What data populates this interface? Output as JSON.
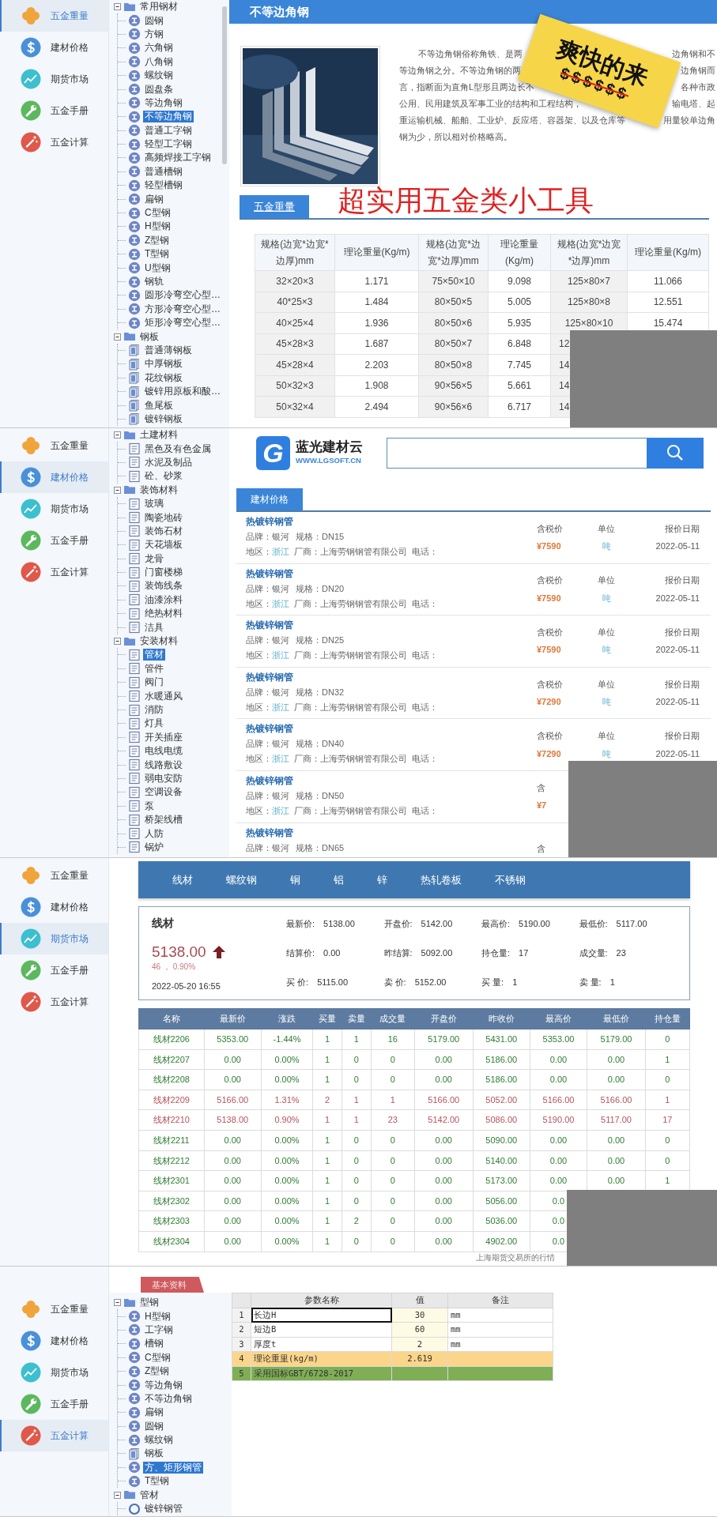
{
  "panels": [
    {
      "kind": "weight",
      "nav": [
        {
          "label": "五金重量",
          "selected": true
        },
        {
          "label": "建材价格",
          "selected": false
        },
        {
          "label": "期货市场",
          "selected": false
        },
        {
          "label": "五金手册",
          "selected": false
        },
        {
          "label": "五金计算",
          "selected": false
        }
      ],
      "tree": [
        {
          "label": "常用钢材",
          "kind": "folder",
          "expanded": true,
          "selected": false,
          "children": [
            {
              "label": "圆钢",
              "kind": "ibeam",
              "selected": false
            },
            {
              "label": "方钢",
              "kind": "ibeam",
              "selected": false
            },
            {
              "label": "六角钢",
              "kind": "ibeam",
              "selected": false
            },
            {
              "label": "八角钢",
              "kind": "ibeam",
              "selected": false
            },
            {
              "label": "螺纹钢",
              "kind": "ibeam",
              "selected": false
            },
            {
              "label": "圆盘条",
              "kind": "ibeam",
              "selected": false
            },
            {
              "label": "等边角钢",
              "kind": "ibeam",
              "selected": false
            },
            {
              "label": "不等边角钢",
              "kind": "ibeam",
              "selected": true
            },
            {
              "label": "普通工字钢",
              "kind": "ibeam",
              "selected": false
            },
            {
              "label": "轻型工字钢",
              "kind": "ibeam",
              "selected": false
            },
            {
              "label": "高频焊接工字钢",
              "kind": "ibeam",
              "selected": false
            },
            {
              "label": "普通槽钢",
              "kind": "ibeam",
              "selected": false
            },
            {
              "label": "轻型槽钢",
              "kind": "ibeam",
              "selected": false
            },
            {
              "label": "扁钢",
              "kind": "ibeam",
              "selected": false
            },
            {
              "label": "C型钢",
              "kind": "ibeam",
              "selected": false
            },
            {
              "label": "H型钢",
              "kind": "ibeam",
              "selected": false
            },
            {
              "label": "Z型钢",
              "kind": "ibeam",
              "selected": false
            },
            {
              "label": "T型钢",
              "kind": "ibeam",
              "selected": false
            },
            {
              "label": "U型钢",
              "kind": "ibeam",
              "selected": false
            },
            {
              "label": "钢轨",
              "kind": "ibeam",
              "selected": false
            },
            {
              "label": "圆形冷弯空心型…",
              "kind": "ibeam",
              "selected": false
            },
            {
              "label": "方形冷弯空心型…",
              "kind": "ibeam",
              "selected": false
            },
            {
              "label": "矩形冷弯空心型…",
              "kind": "ibeam",
              "selected": false
            }
          ]
        },
        {
          "label": "钢板",
          "kind": "folder",
          "expanded": true,
          "selected": false,
          "children": [
            {
              "label": "普通薄钢板",
              "kind": "plate",
              "selected": false
            },
            {
              "label": "中厚钢板",
              "kind": "plate",
              "selected": false
            },
            {
              "label": "花纹钢板",
              "kind": "plate",
              "selected": false
            },
            {
              "label": "镀锌用原板和酸…",
              "kind": "plate",
              "selected": false
            },
            {
              "label": "鱼尾板",
              "kind": "plate",
              "selected": false
            },
            {
              "label": "镀锌钢板",
              "kind": "plate",
              "selected": false
            }
          ]
        }
      ],
      "content": {
        "title": "不等边角钢",
        "description": {
          "lines": [
            {
              "left": "不等边角钢俗称角铁、是两",
              "right": "边角钢和不"
            },
            {
              "left": "等边角钢之分。不等边角钢的两",
              "right": "边角钢而"
            },
            {
              "left": "言，指断面为直角L型形且两边长不",
              "right": "各种市政"
            },
            {
              "left": "公用、民用建筑及军事工业的结构和工程结构，",
              "right": "输电塔、起"
            },
            {
              "left": "重运输机械、船舶、工业炉、反应塔、容器架、以及仓库等",
              "right": "用量较单边角"
            }
          ],
          "last": "钢为少，所以相对价格略高。"
        },
        "sticker": {
          "title": "爽快的来",
          "marks": "$$$$$$"
        },
        "section_tab": "五金重量",
        "banner": "超实用五金类小工具",
        "table": {
          "columns": [
            "规格(边宽*边宽*边厚)mm",
            "理论重量(Kg/m)",
            "规格(边宽*边宽*边厚)mm",
            "理论重量(Kg/m)",
            "规格(边宽*边宽*边厚)mm",
            "理论重量(Kg/m)"
          ],
          "rows": [
            [
              "32×20×3",
              "1.171",
              "75×50×10",
              "9.098",
              "125×80×7",
              "11.066"
            ],
            [
              "40*25×3",
              "1.484",
              "80×50×5",
              "5.005",
              "125×80×8",
              "12.551"
            ],
            [
              "40×25×4",
              "1.936",
              "80×50×6",
              "5.935",
              "125×80×10",
              "15.474"
            ],
            [
              "45×28×3",
              "1.687",
              "80×50×7",
              "6.848",
              "12",
              null
            ],
            [
              "45×28×4",
              "2.203",
              "80×50×8",
              "7.745",
              "14",
              null
            ],
            [
              "50×32×3",
              "1.908",
              "90×56×5",
              "5.661",
              "14",
              null
            ],
            [
              "50×32×4",
              "2.494",
              "90×56×6",
              "6.717",
              "14",
              null
            ]
          ]
        }
      }
    },
    {
      "kind": "prices",
      "nav": [
        {
          "label": "五金重量",
          "selected": false
        },
        {
          "label": "建材价格",
          "selected": true
        },
        {
          "label": "期货市场",
          "selected": false
        },
        {
          "label": "五金手册",
          "selected": false
        },
        {
          "label": "五金计算",
          "selected": false
        }
      ],
      "tree": [
        {
          "label": "土建材料",
          "kind": "folder",
          "expanded": true,
          "selected": false,
          "children": [
            {
              "label": "黑色及有色金属",
              "kind": "doc",
              "selected": false
            },
            {
              "label": "水泥及制品",
              "kind": "doc",
              "selected": false
            },
            {
              "label": "砼、砂浆",
              "kind": "doc",
              "selected": false
            }
          ]
        },
        {
          "label": "装饰材料",
          "kind": "folder",
          "expanded": true,
          "selected": false,
          "children": [
            {
              "label": "玻璃",
              "kind": "doc",
              "selected": false
            },
            {
              "label": "陶瓷地砖",
              "kind": "doc",
              "selected": false
            },
            {
              "label": "装饰石材",
              "kind": "doc",
              "selected": false
            },
            {
              "label": "天花墙板",
              "kind": "doc",
              "selected": false
            },
            {
              "label": "龙骨",
              "kind": "doc",
              "selected": false
            },
            {
              "label": "门窗楼梯",
              "kind": "doc",
              "selected": false
            },
            {
              "label": "装饰线条",
              "kind": "doc",
              "selected": false
            },
            {
              "label": "油漆涂料",
              "kind": "doc",
              "selected": false
            },
            {
              "label": "绝热材料",
              "kind": "doc",
              "selected": false
            },
            {
              "label": "洁具",
              "kind": "doc",
              "selected": false
            }
          ]
        },
        {
          "label": "安装材料",
          "kind": "folder",
          "expanded": true,
          "selected": false,
          "children": [
            {
              "label": "管材",
              "kind": "doc",
              "selected": true
            },
            {
              "label": "管件",
              "kind": "doc",
              "selected": false
            },
            {
              "label": "阀门",
              "kind": "doc",
              "selected": false
            },
            {
              "label": "水暖通风",
              "kind": "doc",
              "selected": false
            },
            {
              "label": "消防",
              "kind": "doc",
              "selected": false
            },
            {
              "label": "灯具",
              "kind": "doc",
              "selected": false
            },
            {
              "label": "开关插座",
              "kind": "doc",
              "selected": false
            },
            {
              "label": "电线电缆",
              "kind": "doc",
              "selected": false
            },
            {
              "label": "线路敷设",
              "kind": "doc",
              "selected": false
            },
            {
              "label": "弱电安防",
              "kind": "doc",
              "selected": false
            },
            {
              "label": "空调设备",
              "kind": "doc",
              "selected": false
            },
            {
              "label": "泵",
              "kind": "doc",
              "selected": false
            },
            {
              "label": "桥架线槽",
              "kind": "doc",
              "selected": false
            },
            {
              "label": "人防",
              "kind": "doc",
              "selected": false
            },
            {
              "label": "锅炉",
              "kind": "doc",
              "selected": false
            }
          ]
        }
      ],
      "content": {
        "logo": {
          "letter": "G",
          "name": "蓝光建材云",
          "url": "WWW.LGSOFT.CN"
        },
        "section_tab": "建材价格",
        "items": [
          {
            "title": "热镀锌钢管",
            "brand": "品牌：银河",
            "spec": "规格：DN15",
            "region_label": "地区：",
            "region": "浙江",
            "maker": "厂商：上海劳钢钢管有限公司",
            "phone": "电话：",
            "price_label": "含税价",
            "price": "¥7590",
            "unit_label": "单位",
            "unit": "吨",
            "date_label": "报价日期",
            "date": "2022-05-11"
          },
          {
            "title": "热镀锌钢管",
            "brand": "品牌：银河",
            "spec": "规格：DN20",
            "region_label": "地区：",
            "region": "浙江",
            "maker": "厂商：上海劳钢钢管有限公司",
            "phone": "电话：",
            "price_label": "含税价",
            "price": "¥7590",
            "unit_label": "单位",
            "unit": "吨",
            "date_label": "报价日期",
            "date": "2022-05-11"
          },
          {
            "title": "热镀锌钢管",
            "brand": "品牌：银河",
            "spec": "规格：DN25",
            "region_label": "地区：",
            "region": "浙江",
            "maker": "厂商：上海劳钢钢管有限公司",
            "phone": "电话：",
            "price_label": "含税价",
            "price": "¥7590",
            "unit_label": "单位",
            "unit": "吨",
            "date_label": "报价日期",
            "date": "2022-05-11"
          },
          {
            "title": "热镀锌钢管",
            "brand": "品牌：银河",
            "spec": "规格：DN32",
            "region_label": "地区：",
            "region": "浙江",
            "maker": "厂商：上海劳钢钢管有限公司",
            "phone": "电话：",
            "price_label": "含税价",
            "price": "¥7290",
            "unit_label": "单位",
            "unit": "吨",
            "date_label": "报价日期",
            "date": "2022-05-11"
          },
          {
            "title": "热镀锌钢管",
            "brand": "品牌：银河",
            "spec": "规格：DN40",
            "region_label": "地区：",
            "region": "浙江",
            "maker": "厂商：上海劳钢钢管有限公司",
            "phone": "电话：",
            "price_label": "含税价",
            "price": "¥7290",
            "unit_label": "单位",
            "unit": "吨",
            "date_label": "报价日期",
            "date": "2022-05-11"
          },
          {
            "title": "热镀锌钢管",
            "brand": "品牌：银河",
            "spec": "规格：DN50",
            "region_label": "地区：",
            "region": "浙江",
            "maker": "厂商：上海劳钢钢管有限公司",
            "phone": "电话：",
            "price_label": "含",
            "price": "¥7"
          },
          {
            "title": "热镀锌钢管",
            "brand": "品牌：银河",
            "spec": "规格：DN65",
            "price_label": "含"
          }
        ]
      }
    },
    {
      "kind": "futures",
      "nav": [
        {
          "label": "五金重量",
          "selected": false
        },
        {
          "label": "建材价格",
          "selected": false
        },
        {
          "label": "期货市场",
          "selected": true
        },
        {
          "label": "五金手册",
          "selected": false
        },
        {
          "label": "五金计算",
          "selected": false
        }
      ],
      "content": {
        "tabs": [
          "线材",
          "螺纹钢",
          "铜",
          "铝",
          "锌",
          "热轧卷板",
          "不锈钢"
        ],
        "quote": {
          "name": "线材",
          "price": "5138.00",
          "rising": true,
          "change": "46 ， 0.90%",
          "time": "2022-05-20 16:55",
          "fields": [
            {
              "label": "最新价:",
              "value": "5138.00"
            },
            {
              "label": "开盘价:",
              "value": "5142.00"
            },
            {
              "label": "最高价:",
              "value": "5190.00"
            },
            {
              "label": "最低价:",
              "value": "5117.00"
            },
            {
              "label": "结算价:",
              "value": "0.00"
            },
            {
              "label": "昨结算:",
              "value": "5092.00"
            },
            {
              "label": "持仓量:",
              "value": "17"
            },
            {
              "label": "成交量:",
              "value": "23"
            },
            {
              "label": "买 价:",
              "value": "5115.00"
            },
            {
              "label": "卖 价:",
              "value": "5152.00"
            },
            {
              "label": "买 量:",
              "value": "1"
            },
            {
              "label": "卖 量:",
              "value": "1"
            }
          ]
        },
        "table": {
          "columns": [
            "名称",
            "最新价",
            "涨跌",
            "买量",
            "卖量",
            "成交量",
            "开盘价",
            "昨收价",
            "最高价",
            "最低价",
            "持仓量"
          ],
          "rows": [
            {
              "color": "#2e7d32",
              "cells": [
                "线材2206",
                "5353.00",
                "-1.44%",
                "1",
                "1",
                "16",
                "5179.00",
                "5431.00",
                "5353.00",
                "5179.00",
                "0"
              ]
            },
            {
              "color": "#2e7d32",
              "cells": [
                "线材2207",
                "0.00",
                "0.00%",
                "1",
                "0",
                "0",
                "0.00",
                "5186.00",
                "0.00",
                "0.00",
                "1"
              ]
            },
            {
              "color": "#2e7d32",
              "cells": [
                "线材2208",
                "0.00",
                "0.00%",
                "1",
                "0",
                "0",
                "0.00",
                "5186.00",
                "0.00",
                "0.00",
                "0"
              ]
            },
            {
              "color": "#b5525a",
              "cells": [
                "线材2209",
                "5166.00",
                "1.31%",
                "2",
                "1",
                "1",
                "5166.00",
                "5052.00",
                "5166.00",
                "5166.00",
                "1"
              ]
            },
            {
              "color": "#b5525a",
              "cells": [
                "线材2210",
                "5138.00",
                "0.90%",
                "1",
                "1",
                "23",
                "5142.00",
                "5086.00",
                "5190.00",
                "5117.00",
                "17"
              ]
            },
            {
              "color": "#2e7d32",
              "cells": [
                "线材2211",
                "0.00",
                "0.00%",
                "1",
                "0",
                "0",
                "0.00",
                "5090.00",
                "0.00",
                "0.00",
                "0"
              ]
            },
            {
              "color": "#2e7d32",
              "cells": [
                "线材2212",
                "0.00",
                "0.00%",
                "1",
                "0",
                "0",
                "0.00",
                "5140.00",
                "0.00",
                "0.00",
                "0"
              ]
            },
            {
              "color": "#2e7d32",
              "cells": [
                "线材2301",
                "0.00",
                "0.00%",
                "1",
                "0",
                "0",
                "0.00",
                "5173.00",
                "0.00",
                "0.00",
                "1"
              ]
            },
            {
              "color": "#2e7d32",
              "cells": [
                "线材2302",
                "0.00",
                "0.00%",
                "1",
                "0",
                "0",
                "0.00",
                "5056.00",
                "0.0",
                null,
                null
              ]
            },
            {
              "color": "#2e7d32",
              "cells": [
                "线材2303",
                "0.00",
                "0.00%",
                "1",
                "2",
                "0",
                "0.00",
                "5036.00",
                "0.0",
                null,
                null
              ]
            },
            {
              "color": "#2e7d32",
              "cells": [
                "线材2304",
                "0.00",
                "0.00%",
                "1",
                "0",
                "0",
                "0.00",
                "4902.00",
                "0.0",
                null,
                null
              ]
            }
          ]
        },
        "footer": "上海期货交易所的行情"
      }
    },
    {
      "kind": "calc",
      "nav": [
        {
          "label": "五金重量",
          "selected": false
        },
        {
          "label": "建材价格",
          "selected": false
        },
        {
          "label": "期货市场",
          "selected": false
        },
        {
          "label": "五金手册",
          "selected": false
        },
        {
          "label": "五金计算",
          "selected": true
        }
      ],
      "section_tab": "基本资料",
      "tree": [
        {
          "label": "型钢",
          "kind": "folder",
          "expanded": true,
          "selected": false,
          "children": [
            {
              "label": "H型钢",
              "kind": "ibeam",
              "selected": false
            },
            {
              "label": "工字钢",
              "kind": "ibeam",
              "selected": false
            },
            {
              "label": "槽钢",
              "kind": "ibeam",
              "selected": false
            },
            {
              "label": "C型钢",
              "kind": "ibeam",
              "selected": false
            },
            {
              "label": "Z型钢",
              "kind": "ibeam",
              "selected": false
            },
            {
              "label": "等边角钢",
              "kind": "ibeam",
              "selected": false
            },
            {
              "label": "不等边角钢",
              "kind": "ibeam",
              "selected": false
            },
            {
              "label": "扁钢",
              "kind": "ibeam",
              "selected": false
            },
            {
              "label": "圆钢",
              "kind": "ibeam",
              "selected": false
            },
            {
              "label": "螺纹钢",
              "kind": "ibeam",
              "selected": false
            },
            {
              "label": "钢板",
              "kind": "plate",
              "selected": false
            },
            {
              "label": "方、矩形钢管",
              "kind": "ibeam",
              "selected": true
            },
            {
              "label": "T型钢",
              "kind": "ibeam",
              "selected": false
            }
          ]
        },
        {
          "label": "管材",
          "kind": "folder",
          "expanded": true,
          "selected": false,
          "children": [
            {
              "label": "镀锌钢管",
              "kind": "ring",
              "selected": false
            }
          ]
        }
      ],
      "grid": {
        "columns": [
          "参数名称",
          "值",
          "备注"
        ],
        "rows": [
          {
            "num": "1",
            "name": "长边H",
            "value": "30",
            "note": "mm",
            "kind": "input",
            "selected": true
          },
          {
            "num": "2",
            "name": "短边B",
            "value": "60",
            "note": "mm",
            "kind": "input",
            "selected": false
          },
          {
            "num": "3",
            "name": "厚度t",
            "value": "2",
            "note": "mm",
            "kind": "input",
            "selected": false
          },
          {
            "num": "4",
            "name": "理论重里(kg/m)",
            "value": "2.619",
            "kind": "result",
            "selected": false
          },
          {
            "num": "5",
            "name": "采用国标GBT/6728-2017",
            "kind": "standard",
            "selected": false
          }
        ]
      }
    }
  ]
}
